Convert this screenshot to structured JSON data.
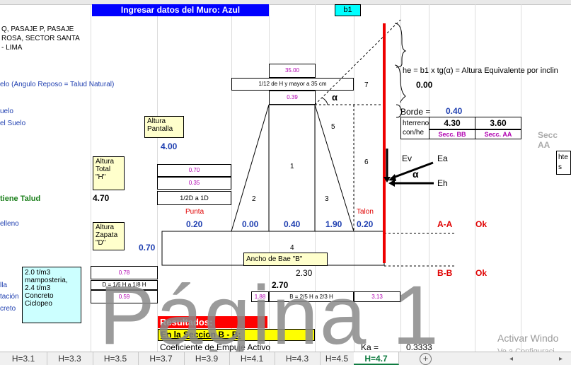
{
  "header": {
    "title": "Ingresar datos del Muro: Azul",
    "b1_label": "b1"
  },
  "address": {
    "line1": "Q, PASAJE P, PASAJE",
    "line2": "ROSA, SECTOR SANTA",
    "line3": "- LIMA"
  },
  "left_labels": {
    "angulo": "elo  (Angulo Reposo = Talud Natural)",
    "suelo": "uelo",
    "del_suelo": "el Suelo",
    "talud": "tiene Talud",
    "relleno": "elleno",
    "lla": "lla",
    "tacion": "tación",
    "creto": "creto"
  },
  "dims": {
    "v_35": "35.00",
    "h12": "1/12 de H y mayor a 35 cm",
    "v_039": "0.39",
    "v_070a": "0.70",
    "v_035b": "0.35",
    "h2d": "1/2D  a 1D",
    "v_078": "0.78",
    "dh": "D = 1/6 H a 1/8 H",
    "v_059": "0.59",
    "v_188": "1.88",
    "bh": "B = 2/5 H a 2/3 H",
    "v_313": "3.13"
  },
  "notes": {
    "altura_pantalla": "Altura Pantalla",
    "pantalla_val": "4.00",
    "altura_total": "Altura Total \"H\"",
    "total_val": "4.70",
    "altura_zapata": "Altura Zapata \"D\"",
    "zapata_val": "0.70",
    "materials": "2.0 t/m3 mamposteria, 2.4 t/m3 Concreto Ciclopeo",
    "ancho": "Ancho de Bae \"B\""
  },
  "sections": {
    "n1": "1",
    "n2": "2",
    "n3": "3",
    "n4": "4",
    "n5": "5",
    "n6": "6",
    "n7": "7",
    "alpha": "α",
    "punta": "Punta",
    "talon": "Talon",
    "p1": "0.20",
    "p2": "0.00",
    "p3": "0.40",
    "p4": "1.90",
    "p5": "0.20",
    "base_val": "2.30",
    "base_total": "2.70"
  },
  "right": {
    "he_formula": "he = b1 x tg(α)  = Altura Equivalente por inclin",
    "he_val": "0.00",
    "borde_label": "Borde =",
    "borde_val": "0.40",
    "hterreno": "hterreno con/he",
    "bb_val": "4.30",
    "aa_val": "3.60",
    "secc_bb": "Secc. BB",
    "secc_aa": "Secc. AA",
    "secc_aa_right": "Secc AA",
    "ev": "Ev",
    "ea": "Ea",
    "eh": "Eh",
    "alpha2": "α",
    "aa": "A-A",
    "ok1": "Ok",
    "bb": "B-B",
    "ok2": "Ok",
    "hte": "hte",
    "s": "s"
  },
  "results": {
    "title": "Resultados:",
    "section": "En la Seccion B - B:",
    "coef": "Coeficiente de Empuje Activo",
    "ka_label": "Ka =",
    "ka_val": "0.3333"
  },
  "watermark": "Página 1",
  "activate": {
    "line1": "Activar Windo",
    "line2": "Ve a Configuraci"
  },
  "tabs": [
    "H=3.1",
    "H=3.3",
    "H=3.5",
    "H=3.7",
    "H=3.9",
    "H=4.1",
    "H=4.3",
    "H=4.5",
    "H=4.7"
  ],
  "active_tab": "H=4.7",
  "colors": {
    "header_blue": "#0000ff",
    "wall_red": "#ee0000",
    "cyan": "#00ffff",
    "result_red": "#ff0000",
    "result_yellow": "#ffff00"
  }
}
